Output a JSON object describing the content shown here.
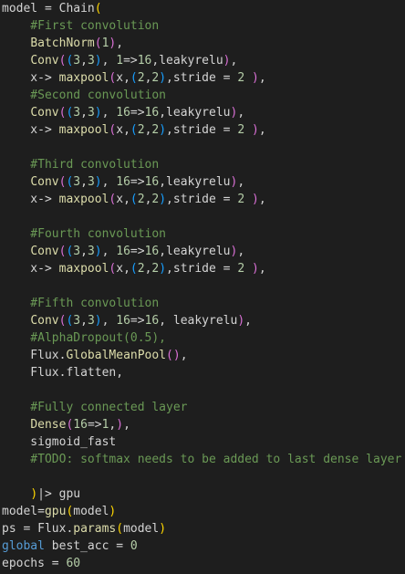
{
  "editor": {
    "lines": [
      [
        {
          "t": "model = Chain",
          "c": "default"
        },
        {
          "t": "(",
          "c": "bracket-1"
        }
      ],
      [
        {
          "t": "    #First convolution",
          "c": "comment"
        }
      ],
      [
        {
          "t": "    ",
          "c": "default"
        },
        {
          "t": "BatchNorm",
          "c": "func"
        },
        {
          "t": "(",
          "c": "bracket-2"
        },
        {
          "t": "1",
          "c": "number"
        },
        {
          "t": ")",
          "c": "bracket-2"
        },
        {
          "t": ",",
          "c": "default"
        }
      ],
      [
        {
          "t": "    ",
          "c": "default"
        },
        {
          "t": "Conv",
          "c": "func"
        },
        {
          "t": "(",
          "c": "bracket-2"
        },
        {
          "t": "(",
          "c": "bracket-3"
        },
        {
          "t": "3",
          "c": "number"
        },
        {
          "t": ",",
          "c": "default"
        },
        {
          "t": "3",
          "c": "number"
        },
        {
          "t": ")",
          "c": "bracket-3"
        },
        {
          "t": ", ",
          "c": "default"
        },
        {
          "t": "1",
          "c": "number"
        },
        {
          "t": "=>",
          "c": "default"
        },
        {
          "t": "16",
          "c": "number"
        },
        {
          "t": ",leakyrelu",
          "c": "default"
        },
        {
          "t": ")",
          "c": "bracket-2"
        },
        {
          "t": ",",
          "c": "default"
        }
      ],
      [
        {
          "t": "    x-> ",
          "c": "default"
        },
        {
          "t": "maxpool",
          "c": "func"
        },
        {
          "t": "(",
          "c": "bracket-2"
        },
        {
          "t": "x,",
          "c": "default"
        },
        {
          "t": "(",
          "c": "bracket-3"
        },
        {
          "t": "2",
          "c": "number"
        },
        {
          "t": ",",
          "c": "default"
        },
        {
          "t": "2",
          "c": "number"
        },
        {
          "t": ")",
          "c": "bracket-3"
        },
        {
          "t": ",stride = ",
          "c": "default"
        },
        {
          "t": "2",
          "c": "number"
        },
        {
          "t": " ",
          "c": "default"
        },
        {
          "t": ")",
          "c": "bracket-2"
        },
        {
          "t": ",",
          "c": "default"
        }
      ],
      [
        {
          "t": "    #Second convolution",
          "c": "comment"
        }
      ],
      [
        {
          "t": "    ",
          "c": "default"
        },
        {
          "t": "Conv",
          "c": "func"
        },
        {
          "t": "(",
          "c": "bracket-2"
        },
        {
          "t": "(",
          "c": "bracket-3"
        },
        {
          "t": "3",
          "c": "number"
        },
        {
          "t": ",",
          "c": "default"
        },
        {
          "t": "3",
          "c": "number"
        },
        {
          "t": ")",
          "c": "bracket-3"
        },
        {
          "t": ", ",
          "c": "default"
        },
        {
          "t": "16",
          "c": "number"
        },
        {
          "t": "=>",
          "c": "default"
        },
        {
          "t": "16",
          "c": "number"
        },
        {
          "t": ",leakyrelu",
          "c": "default"
        },
        {
          "t": ")",
          "c": "bracket-2"
        },
        {
          "t": ",",
          "c": "default"
        }
      ],
      [
        {
          "t": "    x-> ",
          "c": "default"
        },
        {
          "t": "maxpool",
          "c": "func"
        },
        {
          "t": "(",
          "c": "bracket-2"
        },
        {
          "t": "x,",
          "c": "default"
        },
        {
          "t": "(",
          "c": "bracket-3"
        },
        {
          "t": "2",
          "c": "number"
        },
        {
          "t": ",",
          "c": "default"
        },
        {
          "t": "2",
          "c": "number"
        },
        {
          "t": ")",
          "c": "bracket-3"
        },
        {
          "t": ",stride = ",
          "c": "default"
        },
        {
          "t": "2",
          "c": "number"
        },
        {
          "t": " ",
          "c": "default"
        },
        {
          "t": ")",
          "c": "bracket-2"
        },
        {
          "t": ",",
          "c": "default"
        }
      ],
      [],
      [
        {
          "t": "    #Third convolution",
          "c": "comment"
        }
      ],
      [
        {
          "t": "    ",
          "c": "default"
        },
        {
          "t": "Conv",
          "c": "func"
        },
        {
          "t": "(",
          "c": "bracket-2"
        },
        {
          "t": "(",
          "c": "bracket-3"
        },
        {
          "t": "3",
          "c": "number"
        },
        {
          "t": ",",
          "c": "default"
        },
        {
          "t": "3",
          "c": "number"
        },
        {
          "t": ")",
          "c": "bracket-3"
        },
        {
          "t": ", ",
          "c": "default"
        },
        {
          "t": "16",
          "c": "number"
        },
        {
          "t": "=>",
          "c": "default"
        },
        {
          "t": "16",
          "c": "number"
        },
        {
          "t": ",leakyrelu",
          "c": "default"
        },
        {
          "t": ")",
          "c": "bracket-2"
        },
        {
          "t": ",",
          "c": "default"
        }
      ],
      [
        {
          "t": "    x-> ",
          "c": "default"
        },
        {
          "t": "maxpool",
          "c": "func"
        },
        {
          "t": "(",
          "c": "bracket-2"
        },
        {
          "t": "x,",
          "c": "default"
        },
        {
          "t": "(",
          "c": "bracket-3"
        },
        {
          "t": "2",
          "c": "number"
        },
        {
          "t": ",",
          "c": "default"
        },
        {
          "t": "2",
          "c": "number"
        },
        {
          "t": ")",
          "c": "bracket-3"
        },
        {
          "t": ",stride = ",
          "c": "default"
        },
        {
          "t": "2",
          "c": "number"
        },
        {
          "t": " ",
          "c": "default"
        },
        {
          "t": ")",
          "c": "bracket-2"
        },
        {
          "t": ",",
          "c": "default"
        }
      ],
      [],
      [
        {
          "t": "    #Fourth convolution",
          "c": "comment"
        }
      ],
      [
        {
          "t": "    ",
          "c": "default"
        },
        {
          "t": "Conv",
          "c": "func"
        },
        {
          "t": "(",
          "c": "bracket-2"
        },
        {
          "t": "(",
          "c": "bracket-3"
        },
        {
          "t": "3",
          "c": "number"
        },
        {
          "t": ",",
          "c": "default"
        },
        {
          "t": "3",
          "c": "number"
        },
        {
          "t": ")",
          "c": "bracket-3"
        },
        {
          "t": ", ",
          "c": "default"
        },
        {
          "t": "16",
          "c": "number"
        },
        {
          "t": "=>",
          "c": "default"
        },
        {
          "t": "16",
          "c": "number"
        },
        {
          "t": ",leakyrelu",
          "c": "default"
        },
        {
          "t": ")",
          "c": "bracket-2"
        },
        {
          "t": ",",
          "c": "default"
        }
      ],
      [
        {
          "t": "    x-> ",
          "c": "default"
        },
        {
          "t": "maxpool",
          "c": "func"
        },
        {
          "t": "(",
          "c": "bracket-2"
        },
        {
          "t": "x,",
          "c": "default"
        },
        {
          "t": "(",
          "c": "bracket-3"
        },
        {
          "t": "2",
          "c": "number"
        },
        {
          "t": ",",
          "c": "default"
        },
        {
          "t": "2",
          "c": "number"
        },
        {
          "t": ")",
          "c": "bracket-3"
        },
        {
          "t": ",stride = ",
          "c": "default"
        },
        {
          "t": "2",
          "c": "number"
        },
        {
          "t": " ",
          "c": "default"
        },
        {
          "t": ")",
          "c": "bracket-2"
        },
        {
          "t": ",",
          "c": "default"
        }
      ],
      [],
      [
        {
          "t": "    #Fifth convolution",
          "c": "comment"
        }
      ],
      [
        {
          "t": "    ",
          "c": "default"
        },
        {
          "t": "Conv",
          "c": "func"
        },
        {
          "t": "(",
          "c": "bracket-2"
        },
        {
          "t": "(",
          "c": "bracket-3"
        },
        {
          "t": "3",
          "c": "number"
        },
        {
          "t": ",",
          "c": "default"
        },
        {
          "t": "3",
          "c": "number"
        },
        {
          "t": ")",
          "c": "bracket-3"
        },
        {
          "t": ", ",
          "c": "default"
        },
        {
          "t": "16",
          "c": "number"
        },
        {
          "t": "=>",
          "c": "default"
        },
        {
          "t": "16",
          "c": "number"
        },
        {
          "t": ", leakyrelu",
          "c": "default"
        },
        {
          "t": ")",
          "c": "bracket-2"
        },
        {
          "t": ",",
          "c": "default"
        }
      ],
      [
        {
          "t": "    #AlphaDropout(0.5),",
          "c": "comment"
        }
      ],
      [
        {
          "t": "    Flux.",
          "c": "default"
        },
        {
          "t": "GlobalMeanPool",
          "c": "func"
        },
        {
          "t": "(",
          "c": "bracket-2"
        },
        {
          "t": ")",
          "c": "bracket-2"
        },
        {
          "t": ",",
          "c": "default"
        }
      ],
      [
        {
          "t": "    Flux.flatten,",
          "c": "default"
        }
      ],
      [],
      [
        {
          "t": "    #Fully connected layer",
          "c": "comment"
        }
      ],
      [
        {
          "t": "    ",
          "c": "default"
        },
        {
          "t": "Dense",
          "c": "func"
        },
        {
          "t": "(",
          "c": "bracket-2"
        },
        {
          "t": "16",
          "c": "number"
        },
        {
          "t": "=>",
          "c": "default"
        },
        {
          "t": "1",
          "c": "number"
        },
        {
          "t": ",",
          "c": "default"
        },
        {
          "t": ")",
          "c": "bracket-2"
        },
        {
          "t": ",",
          "c": "default"
        }
      ],
      [
        {
          "t": "    sigmoid_fast",
          "c": "default"
        }
      ],
      [
        {
          "t": "    #TODO: softmax needs to be added to last dense layer",
          "c": "comment"
        }
      ],
      [],
      [
        {
          "t": "    ",
          "c": "default"
        },
        {
          "t": ")",
          "c": "bracket-1"
        },
        {
          "t": "|> gpu",
          "c": "default"
        }
      ],
      [
        {
          "t": "model=",
          "c": "default"
        },
        {
          "t": "gpu",
          "c": "func"
        },
        {
          "t": "(",
          "c": "bracket-1"
        },
        {
          "t": "model",
          "c": "default"
        },
        {
          "t": ")",
          "c": "bracket-1"
        }
      ],
      [
        {
          "t": "ps = Flux.",
          "c": "default"
        },
        {
          "t": "params",
          "c": "func"
        },
        {
          "t": "(",
          "c": "bracket-1"
        },
        {
          "t": "model",
          "c": "default"
        },
        {
          "t": ")",
          "c": "bracket-1"
        }
      ],
      [
        {
          "t": "global",
          "c": "keyword"
        },
        {
          "t": " best_acc = ",
          "c": "default"
        },
        {
          "t": "0",
          "c": "number"
        }
      ],
      [
        {
          "t": "epochs = ",
          "c": "default"
        },
        {
          "t": "60",
          "c": "number"
        }
      ]
    ]
  },
  "colors": {
    "background": "#1e1e1e",
    "default": "#d4d4d4",
    "comment": "#6a9955",
    "func": "#dcdcaa",
    "number": "#b5cea8",
    "keyword": "#569cd6",
    "bracket-1": "#ffd700",
    "bracket-2": "#da70d6",
    "bracket-3": "#179fff"
  }
}
